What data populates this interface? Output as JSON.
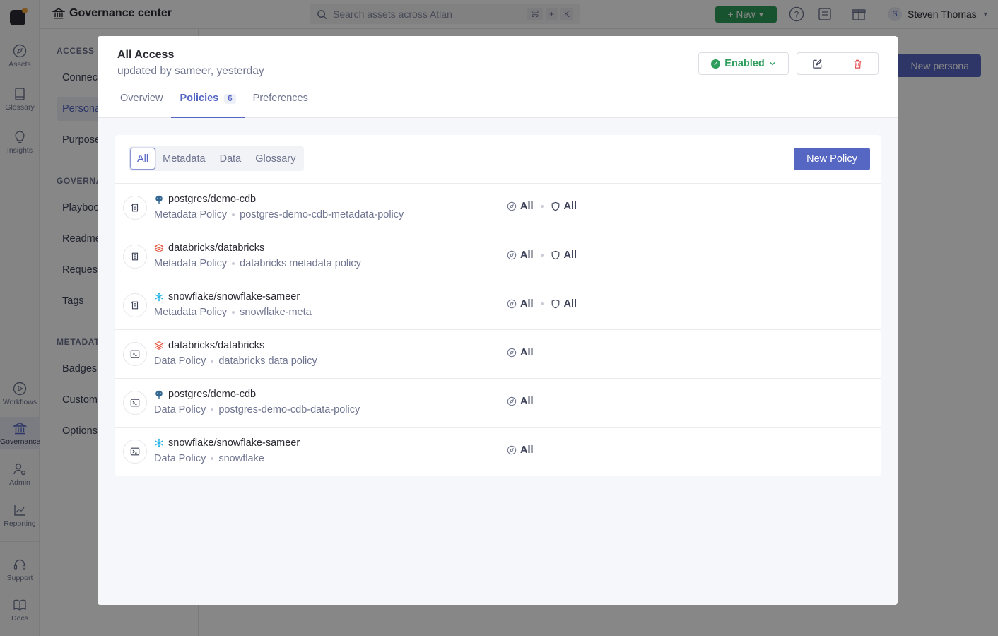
{
  "rail": {
    "items": [
      {
        "label": "Assets",
        "icon": "compass-icon"
      },
      {
        "label": "Glossary",
        "icon": "book-icon"
      },
      {
        "label": "Insights",
        "icon": "bulb-icon"
      },
      {
        "label": "Workflows",
        "icon": "play-circle-icon"
      },
      {
        "label": "Governance",
        "icon": "bank-icon"
      },
      {
        "label": "Admin",
        "icon": "users-gear-icon"
      },
      {
        "label": "Reporting",
        "icon": "chart-line-icon"
      },
      {
        "label": "Support",
        "icon": "headset-icon"
      },
      {
        "label": "Docs",
        "icon": "open-book-icon"
      }
    ]
  },
  "topbar": {
    "title": "Governance center",
    "search_placeholder": "Search assets across Atlan",
    "shortcut": [
      "⌘",
      "+",
      "K"
    ],
    "new_label": "New",
    "user_initial": "S",
    "user_name": "Steven Thomas"
  },
  "sidenav": {
    "sections": [
      {
        "heading": "ACCESS C",
        "items": [
          "Connec",
          "Persona",
          "Purpose"
        ]
      },
      {
        "heading": "GOVERNA",
        "items": [
          "Playboo",
          "Readme",
          "Request",
          "Tags"
        ]
      },
      {
        "heading": "METADAT",
        "items": [
          "Badges",
          "Custom",
          "Options"
        ]
      }
    ],
    "new_persona_label": "New persona"
  },
  "drawer": {
    "title": "All Access",
    "subtitle": "updated by sameer, yesterday",
    "status_label": "Enabled",
    "tabs": [
      {
        "label": "Overview"
      },
      {
        "label": "Policies",
        "count": "6"
      },
      {
        "label": "Preferences"
      }
    ],
    "filters": [
      "All",
      "Metadata",
      "Data",
      "Glossary"
    ],
    "new_policy_label": "New Policy",
    "policies": [
      {
        "kind": "metadata",
        "source": "postgres",
        "asset": "postgres/demo-cdb",
        "type": "Metadata Policy",
        "name": "postgres-demo-cdb-metadata-policy",
        "perm1": "All",
        "perm2": "All"
      },
      {
        "kind": "metadata",
        "source": "databricks",
        "asset": "databricks/databricks",
        "type": "Metadata Policy",
        "name": "databricks metadata policy",
        "perm1": "All",
        "perm2": "All"
      },
      {
        "kind": "metadata",
        "source": "snowflake",
        "asset": "snowflake/snowflake-sameer",
        "type": "Metadata Policy",
        "name": "snowflake-meta",
        "perm1": "All",
        "perm2": "All"
      },
      {
        "kind": "data",
        "source": "databricks",
        "asset": "databricks/databricks",
        "type": "Data Policy",
        "name": "databricks data policy",
        "perm1": "All"
      },
      {
        "kind": "data",
        "source": "postgres",
        "asset": "postgres/demo-cdb",
        "type": "Data Policy",
        "name": "postgres-demo-cdb-data-policy",
        "perm1": "All"
      },
      {
        "kind": "data",
        "source": "snowflake",
        "asset": "snowflake/snowflake-sameer",
        "type": "Data Policy",
        "name": "snowflake",
        "perm1": "All"
      }
    ]
  },
  "colors": {
    "accent": "#5566c3",
    "success": "#2f9e5c",
    "danger": "#e5484d",
    "databricks": "#e5533d",
    "snowflake": "#29b5e8",
    "postgres": "#336791"
  }
}
